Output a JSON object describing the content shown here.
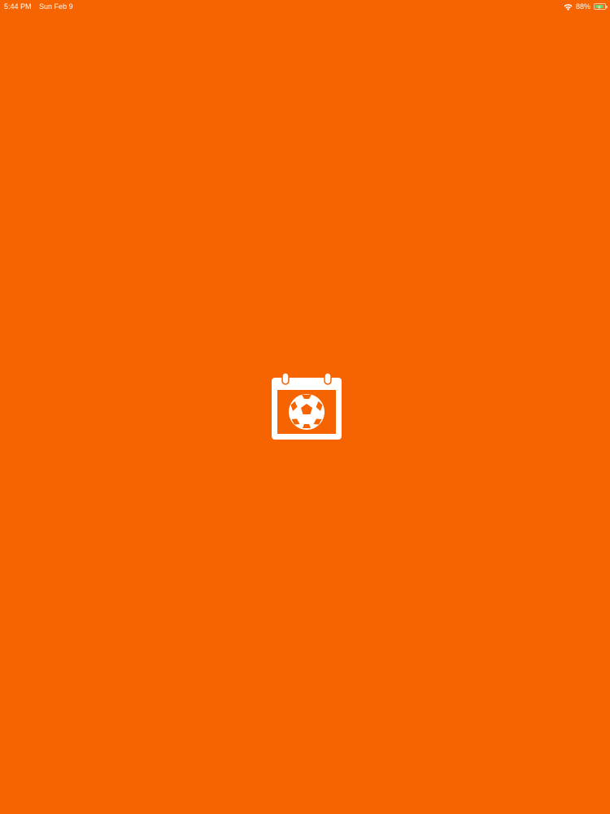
{
  "status_bar": {
    "time": "5:44 PM",
    "date": "Sun Feb 9",
    "battery_percent": "88%",
    "battery_level": 0.88,
    "charging": true,
    "wifi_icon": "wifi-icon",
    "battery_icon": "battery-charging-icon"
  },
  "splash": {
    "background_color": "#f56400",
    "logo_icon": "calendar-soccer-ball-icon",
    "logo_color": "#ffffff"
  }
}
